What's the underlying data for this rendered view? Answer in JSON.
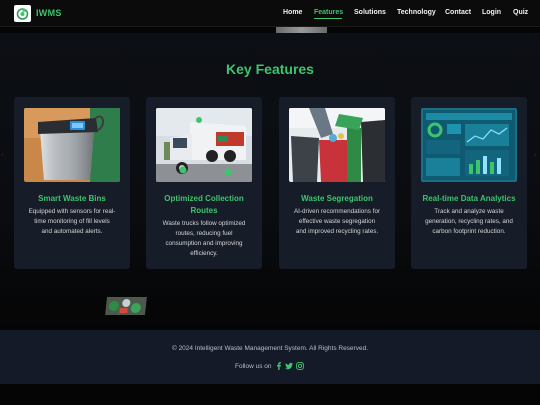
{
  "brand": {
    "name": "IWMS",
    "logo_icon": "recycle-leaf-icon"
  },
  "nav": {
    "items": [
      {
        "label": "Home",
        "active": false
      },
      {
        "label": "Features",
        "active": true
      },
      {
        "label": "Solutions",
        "active": false
      },
      {
        "label": "Technology",
        "active": false
      },
      {
        "label": "Contact",
        "active": false
      },
      {
        "label": "Login",
        "active": false
      },
      {
        "label": "Quiz",
        "active": false
      }
    ]
  },
  "features": {
    "title": "Key Features",
    "cards": [
      {
        "title": "Smart Waste Bins",
        "desc_lines": [
          "Equipped with sensors for real-",
          "time monitoring of fill levels",
          "and automated alerts."
        ],
        "image": "smart-bin-image"
      },
      {
        "title_lines": [
          "Optimized Collection",
          "Routes"
        ],
        "desc_lines": [
          "Waste trucks follow optimized",
          "routes, reducing fuel",
          "consumption and improving",
          "efficiency."
        ],
        "image": "garbage-truck-image"
      },
      {
        "title": "Waste Segregation",
        "desc_lines": [
          "AI-driven recommendations for",
          "effective waste segregation",
          "and improved recycling rates."
        ],
        "image": "recycling-bins-image"
      },
      {
        "title": "Real-time Data Analytics",
        "desc_lines": [
          "Track and analyze waste",
          "generation, recycling rates, and",
          "carbon footprint reduction."
        ],
        "image": "analytics-dashboard-image"
      }
    ]
  },
  "footer": {
    "copyright": "© 2024 Intelligent Waste Management System. All Rights Reserved.",
    "follow_label": "Follow us on",
    "social": [
      "facebook-icon",
      "twitter-icon",
      "instagram-icon"
    ]
  },
  "colors": {
    "accent": "#3ec46d",
    "background": "#050505",
    "card": "#161c28",
    "footer": "#141a27"
  }
}
